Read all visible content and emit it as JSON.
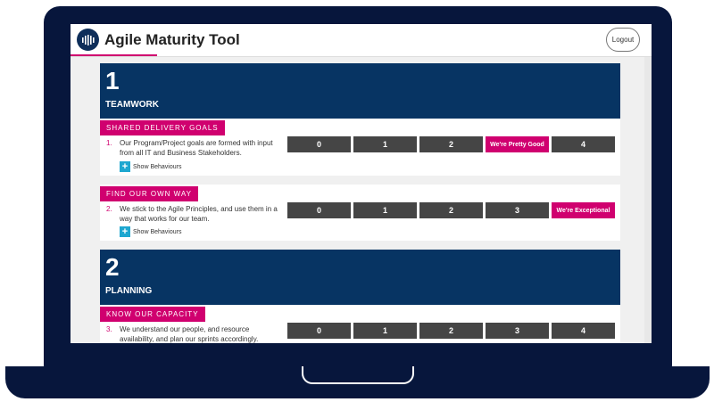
{
  "app": {
    "title": "Agile Maturity Tool",
    "logout_label": "Logout"
  },
  "sections": [
    {
      "number": "1",
      "title": "TEAMWORK",
      "goals": [
        {
          "tag": "SHARED DELIVERY GOALS",
          "index": "1.",
          "question": "Our Program/Project goals are formed with input from all IT and Business Stakeholders.",
          "scale": [
            "0",
            "1",
            "2",
            "We're Pretty Good",
            "4"
          ],
          "selected_index": 3,
          "show_behaviours": "Show Behaviours"
        },
        {
          "tag": "FIND OUR OWN WAY",
          "index": "2.",
          "question": "We stick to the Agile Principles, and use them in a way that works for our team.",
          "scale": [
            "0",
            "1",
            "2",
            "3",
            "We're Exceptional"
          ],
          "selected_index": 4,
          "show_behaviours": "Show Behaviours"
        }
      ]
    },
    {
      "number": "2",
      "title": "PLANNING",
      "goals": [
        {
          "tag": "KNOW OUR CAPACITY",
          "index": "3.",
          "question": "We understand our people, and resource availability, and plan our sprints accordingly.",
          "scale": [
            "0",
            "1",
            "2",
            "3",
            "4"
          ],
          "selected_index": -1
        }
      ]
    }
  ],
  "colors": {
    "navy": "#073463",
    "accent": "#d0006f",
    "button": "#454545",
    "info": "#1ea7d0"
  },
  "icons": {
    "logo": "bar-chart-logo-icon",
    "plus": "plus-icon"
  }
}
